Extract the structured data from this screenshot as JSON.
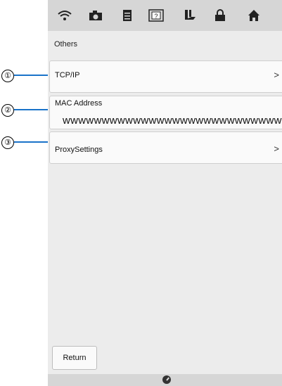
{
  "toolbar": {
    "icons": [
      "wifi-icon",
      "camera-icon",
      "document-icon",
      "help-icon",
      "presser-foot-icon",
      "lock-icon",
      "home-icon"
    ]
  },
  "section_title": "Others",
  "rows": {
    "tcp_ip": "TCP/IP",
    "mac_label": "MAC Address",
    "mac_value": "wwwwwwwwwwwwwwwwwwwwwwwwwwww",
    "proxy": "ProxySettings",
    "chevron": ">"
  },
  "return_label": "Return",
  "callouts": [
    "①",
    "②",
    "③"
  ],
  "colors": {
    "leader": "#1a73c9",
    "toolbar": "#d6d6d6",
    "background": "#ececec"
  }
}
